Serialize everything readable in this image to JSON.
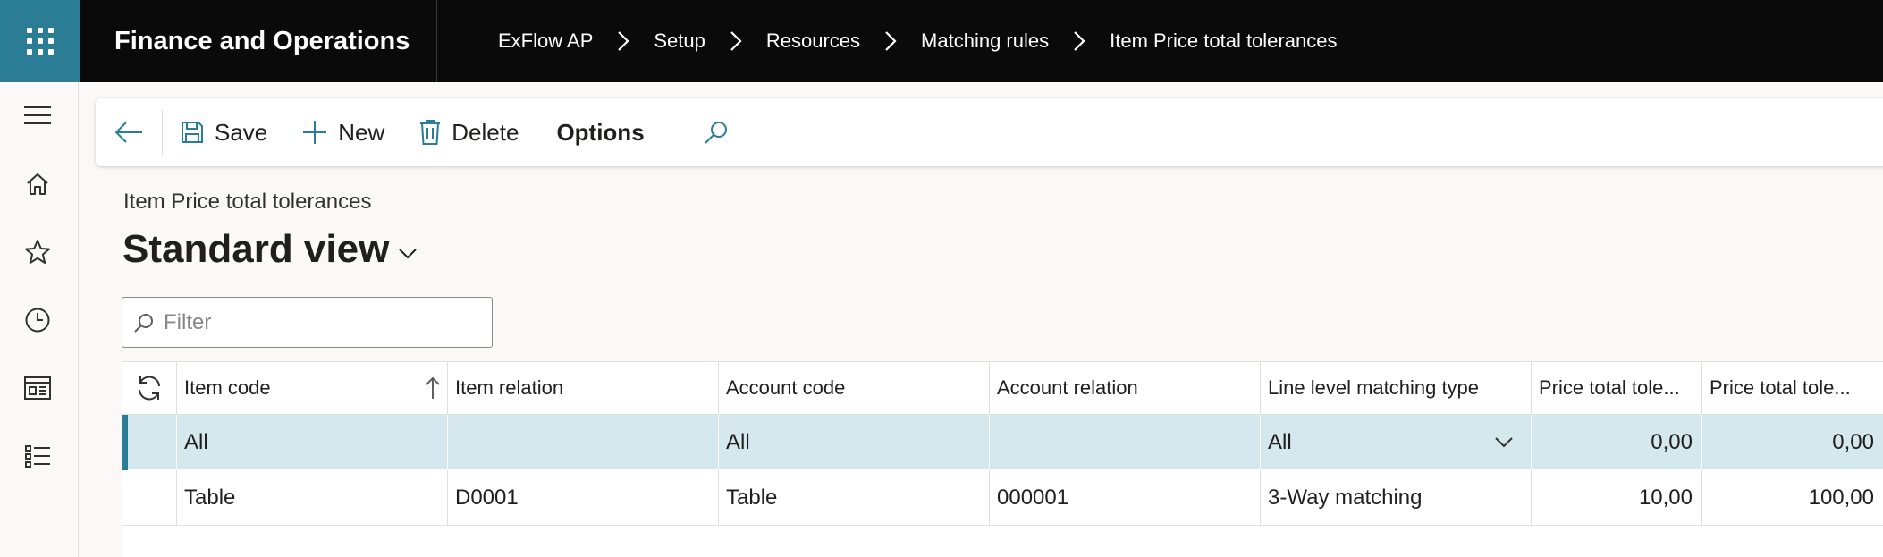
{
  "app": {
    "title": "Finance and Operations"
  },
  "breadcrumbs": [
    "ExFlow AP",
    "Setup",
    "Resources",
    "Matching rules",
    "Item Price total tolerances"
  ],
  "toolbar": {
    "save": "Save",
    "new": "New",
    "delete": "Delete",
    "options": "Options"
  },
  "page": {
    "caption": "Item Price total tolerances",
    "view_title": "Standard view"
  },
  "filter": {
    "placeholder": "Filter",
    "value": ""
  },
  "grid": {
    "columns": [
      "Item code",
      "Item relation",
      "Account code",
      "Account relation",
      "Line level matching type",
      "Price total tole...",
      "Price total tole..."
    ],
    "rows": [
      {
        "item_code": "All",
        "item_relation": "",
        "account_code": "All",
        "account_relation": "",
        "matching_type": "All",
        "tol1": "0,00",
        "tol2": "0,00",
        "selected": true
      },
      {
        "item_code": "Table",
        "item_relation": "D0001",
        "account_code": "Table",
        "account_relation": "000001",
        "matching_type": "3-Way matching",
        "tol1": "10,00",
        "tol2": "100,00",
        "selected": false
      }
    ]
  },
  "icons": {
    "waffle": "app-launcher-icon",
    "back": "back-arrow-icon",
    "save": "save-icon",
    "new": "plus-icon",
    "delete": "trash-icon",
    "search": "search-icon",
    "refresh": "refresh-icon",
    "sort": "sort-ascending-icon",
    "nav": [
      "hamburger-icon",
      "home-icon",
      "star-icon",
      "clock-icon",
      "workspace-icon",
      "list-icon"
    ]
  },
  "colors": {
    "accent": "#2b7d95",
    "topbar": "#0a0a0a",
    "selected_row": "#d4e8ee"
  }
}
